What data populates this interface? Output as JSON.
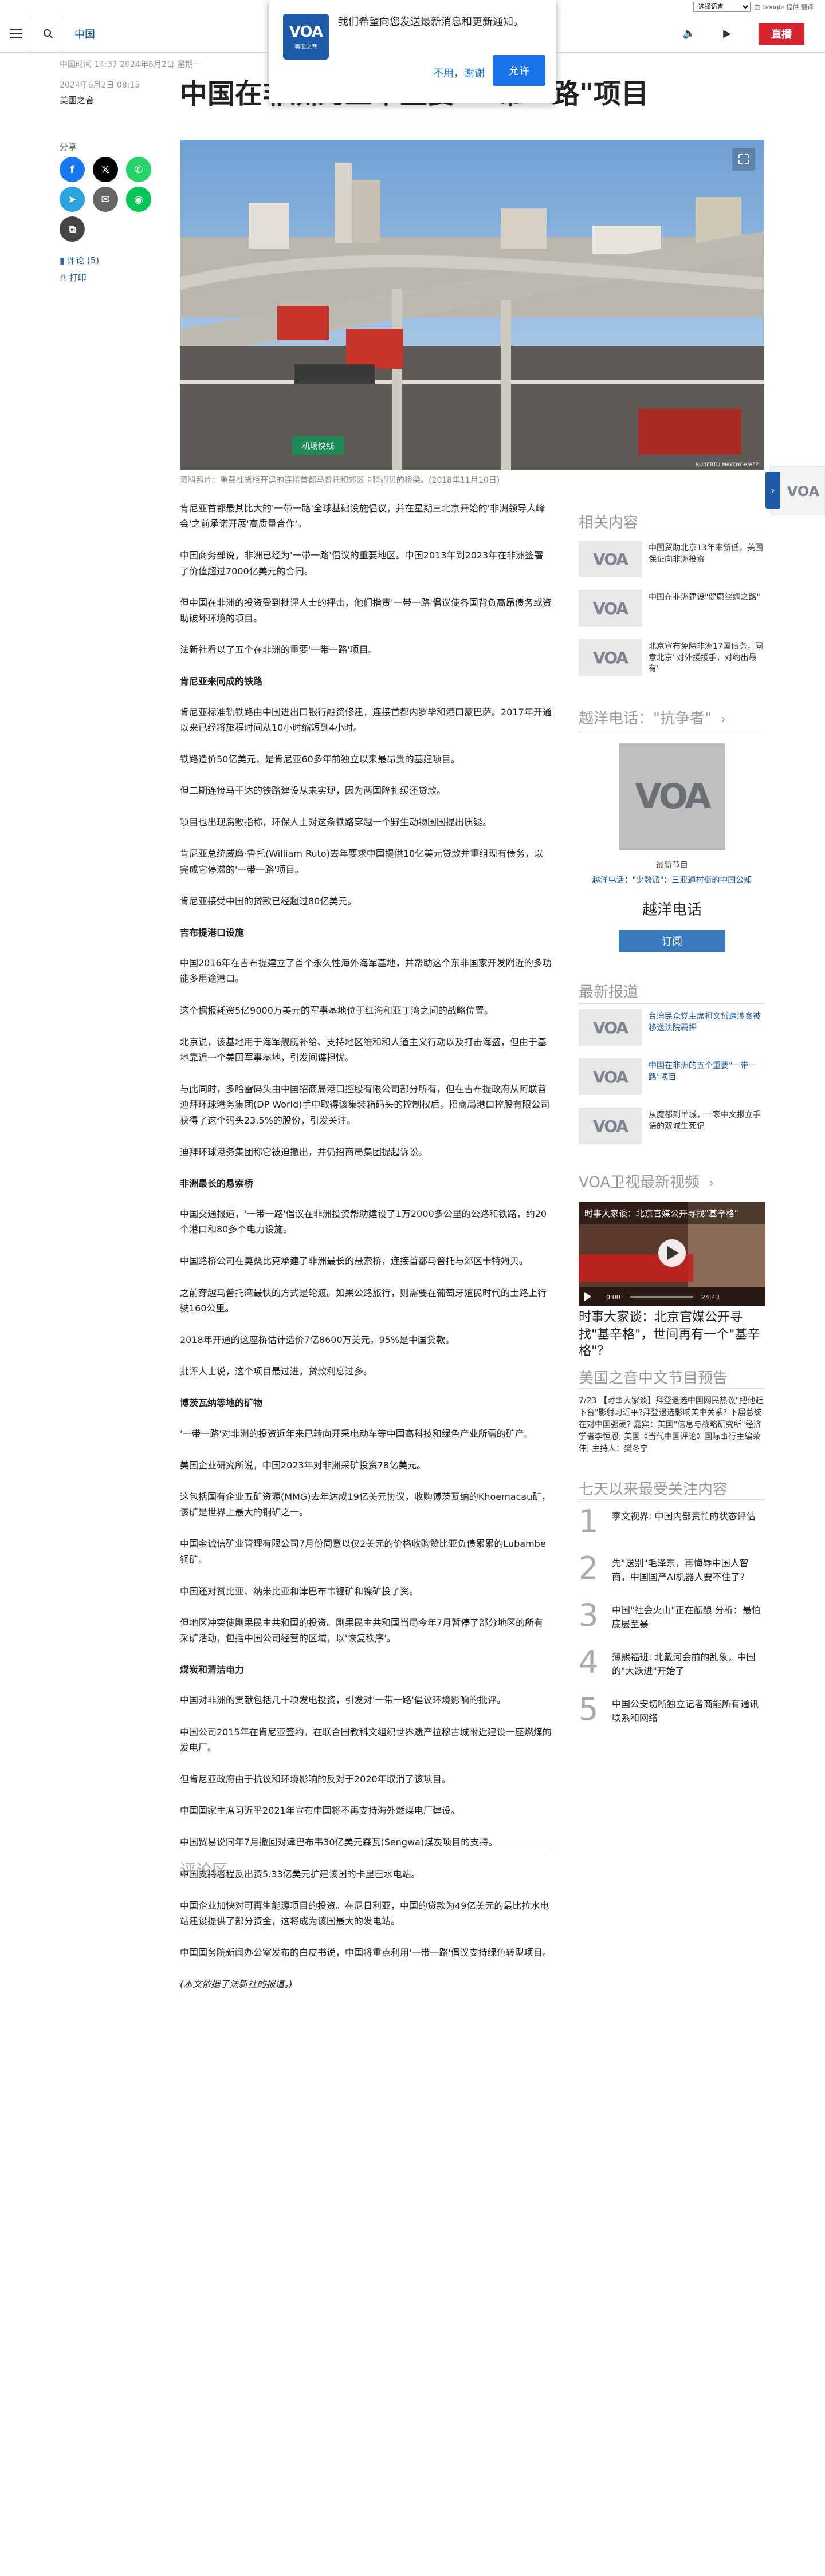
{
  "translate_bar": {
    "select": "选择语言",
    "text": "由 Google 提供 翻译"
  },
  "header": {
    "section": "中国",
    "live": "直播"
  },
  "notification": {
    "logo_text": "VOA",
    "logo_sub": "美国之音",
    "message": "我们希望向您发送最新消息和更新通知。",
    "decline": "不用，谢谢",
    "accept": "允许"
  },
  "meta": {
    "updated": "中国时间 14:37 2024年6月2日 星期一",
    "date": "2024年6月2日 08:15",
    "author": "美国之音"
  },
  "title": "中国在非洲的五个重要\"一带一路\"项目",
  "share": {
    "label": "分享",
    "comments": "评论 (5)",
    "print": "打印"
  },
  "hero": {
    "road_sign": "机场快线",
    "credit": "ROBERTO MAYENGA/AFP",
    "caption": "资料照片：重载社货柜开建的连接首都马普托和郊区卡特姆贝的桥梁。(2018年11月10日)"
  },
  "article": [
    {
      "t": "p",
      "text": "肯尼亚首都最其比大的'一带一路'全球基础设施倡议，并在星期三北京开始的'非洲领导人峰会'之前承诺开展'高质量合作'。"
    },
    {
      "t": "p",
      "text": "中国商务部说，非洲已经为'一带一路'倡议的重要地区。中国2013年到2023年在非洲签署了价值超过7000亿美元的合同。"
    },
    {
      "t": "p",
      "text": "但中国在非洲的投资受到批评人士的抨击，他们指责'一带一路'倡议使各国背负高昂债务或资助破坏环境的项目。"
    },
    {
      "t": "p",
      "text": "法新社看以了五个在非洲的重要'一带一路'项目。"
    },
    {
      "t": "h",
      "text": "肯尼亚来同成的铁路"
    },
    {
      "t": "p",
      "text": "肯尼亚标准轨铁路由中国进出口银行融资修建，连接首都内罗毕和港口蒙巴萨。2017年开通以来已经将旅程时间从10小时缩短到4小时。"
    },
    {
      "t": "p",
      "text": "铁路造价50亿美元，是肯尼亚60多年前独立以来最昂贵的基建项目。"
    },
    {
      "t": "p",
      "text": "但二期连接马干达的铁路建设从未实现，因为两国降扎缓还贷款。"
    },
    {
      "t": "p",
      "text": "项目也出现腐败指称，环保人士对这条铁路穿越一个野生动物国国提出质疑。"
    },
    {
      "t": "p",
      "text": "肯尼亚总统威廉·鲁托(William Ruto)去年要求中国提供10亿美元贷款并重组现有债务，以完成它停滞的'一带一路'项目。"
    },
    {
      "t": "p",
      "text": "肯尼亚接受中国的贷款已经超过80亿美元。"
    },
    {
      "t": "h",
      "text": "吉布提港口设施"
    },
    {
      "t": "p",
      "text": "中国2016年在吉布提建立了首个永久性海外海军基地，并帮助这个东非国家开发附近的多功能多用途港口。"
    },
    {
      "t": "p",
      "text": "这个据报耗资5亿9000万美元的军事基地位于红海和亚丁湾之间的战略位置。"
    },
    {
      "t": "p",
      "text": "北京说，该基地用于海军舰艇补给、支持地区维和和人道主义行动以及打击海盗，但由于基地靠近一个美国军事基地，引发间谍担忧。"
    },
    {
      "t": "p",
      "text": "与此同时，多哈雷码头由中国招商局港口控股有限公司部分所有，但在吉布提政府从阿联酋迪拜环球港务集团(DP World)手中取得该集装箱码头的控制权后，招商局港口控股有限公司获得了这个码头23.5%的股份，引发关注。"
    },
    {
      "t": "p",
      "text": "迪拜环球港务集团称它被迫撤出，并仍招商局集团提起诉讼。"
    },
    {
      "t": "h",
      "text": "非洲最长的悬索桥"
    },
    {
      "t": "p",
      "text": "中国交通报道，'一带一路'倡议在非洲投资帮助建设了1万2000多公里的公路和铁路，约20个港口和80多个电力设施。"
    },
    {
      "t": "p",
      "text": "中国路桥公司在莫桑比克承建了非洲最长的悬索桥，连接首都马普托与郊区卡特姆贝。"
    },
    {
      "t": "p",
      "text": "之前穿越马普托湾最快的方式是轮渡。如果公路旅行，则需要在葡萄牙殖民时代的土路上行驶160公里。"
    },
    {
      "t": "p",
      "text": "2018年开通的这座桥估计造价7亿8600万美元，95%是中国贷款。"
    },
    {
      "t": "p",
      "text": "批评人士说，这个项目最过进，贷款利息过多。"
    },
    {
      "t": "h",
      "text": "博茨瓦纳等地的矿物"
    },
    {
      "t": "p",
      "text": "'一带一路'对非洲的投资近年来已转向开采电动车等中国高科技和绿色产业所需的矿产。"
    },
    {
      "t": "p",
      "text": "美国企业研究所说，中国2023年对非洲采矿投资78亿美元。"
    },
    {
      "t": "p",
      "text": "这包括国有企业五矿资源(MMG)去年达成19亿美元协议，收购博茨瓦纳的Khoemacau矿，该矿是世界上最大的铜矿之一。"
    },
    {
      "t": "p",
      "text": "中国金诚信矿业管理有限公司7月份同意以仅2美元的价格收购赞比亚负债累累的Lubambe铜矿。"
    },
    {
      "t": "p",
      "text": "中国还对赞比亚、纳米比亚和津巴布韦锂矿和镍矿投了资。"
    },
    {
      "t": "p",
      "text": "但地区冲突使刚果民主共和国的投资。刚果民主共和国当局今年7月暂停了部分地区的所有采矿活动，包括中国公司经营的区域，以'恢复秩序'。"
    },
    {
      "t": "h",
      "text": "煤炭和清洁电力"
    },
    {
      "t": "p",
      "text": "中国对非洲的贡献包括几十项发电投资，引发对'一带一路'倡议环境影响的批评。"
    },
    {
      "t": "p",
      "text": "中国公司2015年在肯尼亚签约，在联合国教科文组织世界遗产拉穆古城附近建设一座燃煤的发电厂。"
    },
    {
      "t": "p",
      "text": "但肯尼亚政府由于抗议和环境影响的反对于2020年取消了该项目。"
    },
    {
      "t": "p",
      "text": "中国国家主席习近平2021年宣布中国将不再支持海外燃煤电厂建设。"
    },
    {
      "t": "p",
      "text": "中国贸易说同年7月撤回对津巴布韦30亿美元森瓦(Sengwa)煤炭项目的支持。"
    },
    {
      "t": "p",
      "text": "中国支持者程反出资5.33亿美元扩建该国的卡里巴水电站。"
    },
    {
      "t": "p",
      "text": "中国企业加快对可再生能源项目的投资。在尼日利亚，中国的贷款为49亿美元的最比拉水电站建设提供了部分资金，这将成为该国最大的发电站。"
    },
    {
      "t": "p",
      "text": "中国国务院新闻办公室发布的白皮书说，中国将重点利用'一带一路'倡议支持绿色转型项目。"
    },
    {
      "t": "i",
      "text": "(本文依据了法新社的报道。)"
    }
  ],
  "comments_title": "评论区",
  "sidebar": {
    "related_title": "相关内容",
    "related": [
      "中国贸助北京13年来新低，美国保证向非洲投资",
      "中国在非洲建设\"健康丝绸之路\"",
      "北京宣布免除非洲17国债务，同意北京\"对外援援手，对约出最有\""
    ],
    "podcast_title": "越洋电话：\"抗争者\"",
    "podcast_label": "最新节目",
    "podcast_sub": "越洋电话：\"少数派\"：三亚通村街的中国公知",
    "podcast_name": "越洋电话",
    "subscribe": "订阅",
    "latest_title": "最新报道",
    "latest": [
      "台湾民众党主席柯文哲遭涉贪被 移送法院羁押",
      "中国在非洲的五个重要\"一带一路\"项目",
      "从魔都到羊城，一家中文报立手语的双城生死记"
    ],
    "video_title": "VOA卫视最新视频",
    "video_caption": "时事大家谈：北京官媒公开寻找\"基辛格\"，世间再有一个\"基辛格\"？",
    "video_overlay": "时事大家谈：北京官媒公开寻找\"基辛格\"",
    "video_time": "0:00",
    "video_duration": "24:43",
    "preview_title": "美国之音中文节目预告",
    "preview_text": "7/23 【时事大家谈】拜登退选中国网民热议\"把他赶下台\"影射习近平?拜登退选影响美中关系? 下届总统在对中国强硬? 嘉宾：美国\"信息与战略研究所\"经济学者李恒恩; 美国《当代中国评论》国际事行主编荣伟; 主持人：樊冬宁",
    "popular_title": "七天以来最受关注内容",
    "popular": [
      {
        "n": "1",
        "text": "李文视界: 中国内部责忙的状态评估"
      },
      {
        "n": "2",
        "text": "先\"送别\"毛泽东，再悔辱中国人智商，中国国产AI机器人要不住了?"
      },
      {
        "n": "3",
        "text": "中国\"社会火山\"正在酝酿 分析：最怕底层至暴"
      },
      {
        "n": "4",
        "text": "薄熙福班: 北戴河会前的乱象，中国的\"大跃进\"开始了"
      },
      {
        "n": "5",
        "text": "中国公安切断独立记者商能所有通讯联系和网络"
      }
    ]
  },
  "colors": {
    "brand": "#1d5aa8",
    "live": "#d4222f",
    "accept": "#1a73e8"
  }
}
